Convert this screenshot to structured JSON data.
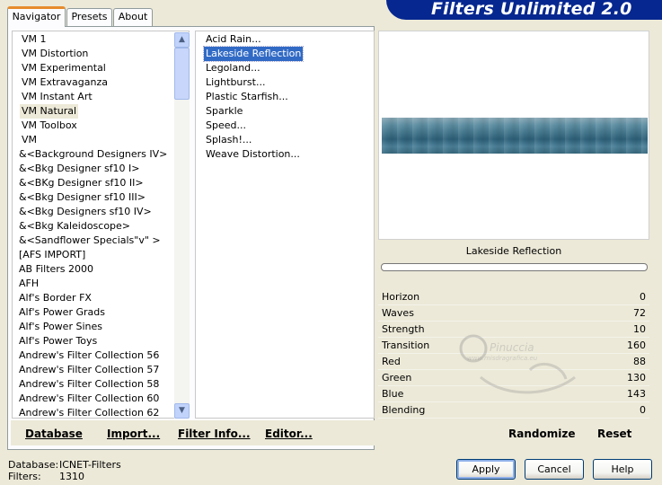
{
  "tabs": [
    {
      "label": "Navigator"
    },
    {
      "label": "Presets"
    },
    {
      "label": "About"
    }
  ],
  "title": "Filters Unlimited 2.0",
  "categories": [
    "VM 1",
    "VM Distortion",
    "VM Experimental",
    "VM Extravaganza",
    "VM Instant Art",
    "VM Natural",
    "VM Toolbox",
    "VM",
    "&<Background Designers IV>",
    "&<Bkg Designer sf10 I>",
    "&<BKg Designer sf10 II>",
    "&<Bkg Designer sf10 III>",
    "&<Bkg Designers sf10 IV>",
    "&<Bkg Kaleidoscope>",
    "&<Sandflower Specials\"v\" >",
    "[AFS IMPORT]",
    "AB Filters 2000",
    "AFH",
    "Alf's Border FX",
    "Alf's Power Grads",
    "Alf's Power Sines",
    "Alf's Power Toys",
    "Andrew's Filter Collection 56",
    "Andrew's Filter Collection 57",
    "Andrew's Filter Collection 58",
    "Andrew's Filter Collection 60",
    "Andrew's Filter Collection 62"
  ],
  "selected_category": "VM Natural",
  "filters": [
    "Acid Rain...",
    "Lakeside Reflection",
    "Legoland...",
    "Lightburst...",
    "Plastic Starfish...",
    "Sparkle",
    "Speed...",
    "Splash!...",
    "Weave Distortion..."
  ],
  "selected_filter": "Lakeside Reflection",
  "link_buttons": {
    "database": "Database",
    "import": "Import...",
    "filter_info": "Filter Info...",
    "editor": "Editor..."
  },
  "preview_filter_name": "Lakeside Reflection",
  "progress": 0,
  "parameters": [
    {
      "label": "Horizon",
      "value": "0"
    },
    {
      "label": "Waves",
      "value": "72"
    },
    {
      "label": "Strength",
      "value": "10"
    },
    {
      "label": "Transition",
      "value": "160"
    },
    {
      "label": "Red",
      "value": "88"
    },
    {
      "label": "Green",
      "value": "130"
    },
    {
      "label": "Blue",
      "value": "143"
    },
    {
      "label": "Blending",
      "value": "0"
    }
  ],
  "randomize_label": "Randomize",
  "reset_label": "Reset",
  "footer": {
    "database_label": "Database:",
    "database_value": "ICNET-Filters",
    "filters_label": "Filters:",
    "filters_value": "1310"
  },
  "buttons": {
    "apply": "Apply",
    "cancel": "Cancel",
    "help": "Help"
  },
  "watermark": {
    "name": "Pinuccia",
    "url": "www.misdragrafica.eu"
  },
  "colors": {
    "banner": "#06278f",
    "selection": "#316ac5",
    "active_tab_accent": "#e68b2c"
  }
}
